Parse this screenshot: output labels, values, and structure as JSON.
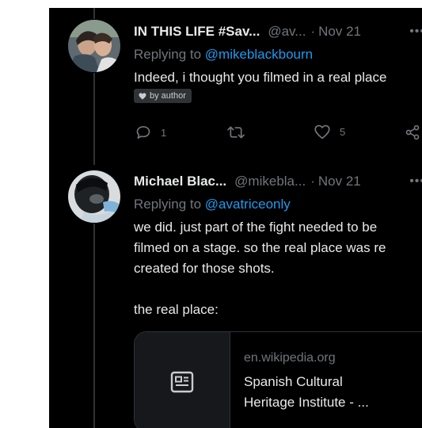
{
  "tweets": [
    {
      "display_name": "IN THIS LIFE #Sav...",
      "handle": "@av...",
      "separator": "·",
      "date": "Nov 21",
      "replying_prefix": "Replying to ",
      "replying_to": "@mikeblackbourn",
      "text": "Indeed, i thought you filmed in a real place",
      "badge": "by author",
      "reply_count": "1",
      "retweet_count": "",
      "like_count": "5"
    },
    {
      "display_name": "Michael Blac...",
      "handle": "@mikebla...",
      "separator": "·",
      "date": "Nov 21",
      "replying_prefix": "Replying to ",
      "replying_to": "@avatriceonly",
      "text": "we did. just part of the fight needed to be\nfilmed on a stage. so the real place was re\ncreated for those shots.\n\nthe real place:",
      "link_card": {
        "domain": "en.wikipedia.org",
        "title": "Spanish Cultural\nHeritage Institute - ..."
      }
    }
  ],
  "colors": {
    "background": "#000000",
    "text_primary": "#e7e9ea",
    "text_secondary": "#71767b",
    "accent": "#1d9bf0"
  },
  "icons": {
    "more": "more-horizontal-icon",
    "reply": "reply-icon",
    "retweet": "retweet-icon",
    "like": "heart-icon",
    "share": "share-icon",
    "badge": "heart-icon",
    "card": "article-icon"
  }
}
